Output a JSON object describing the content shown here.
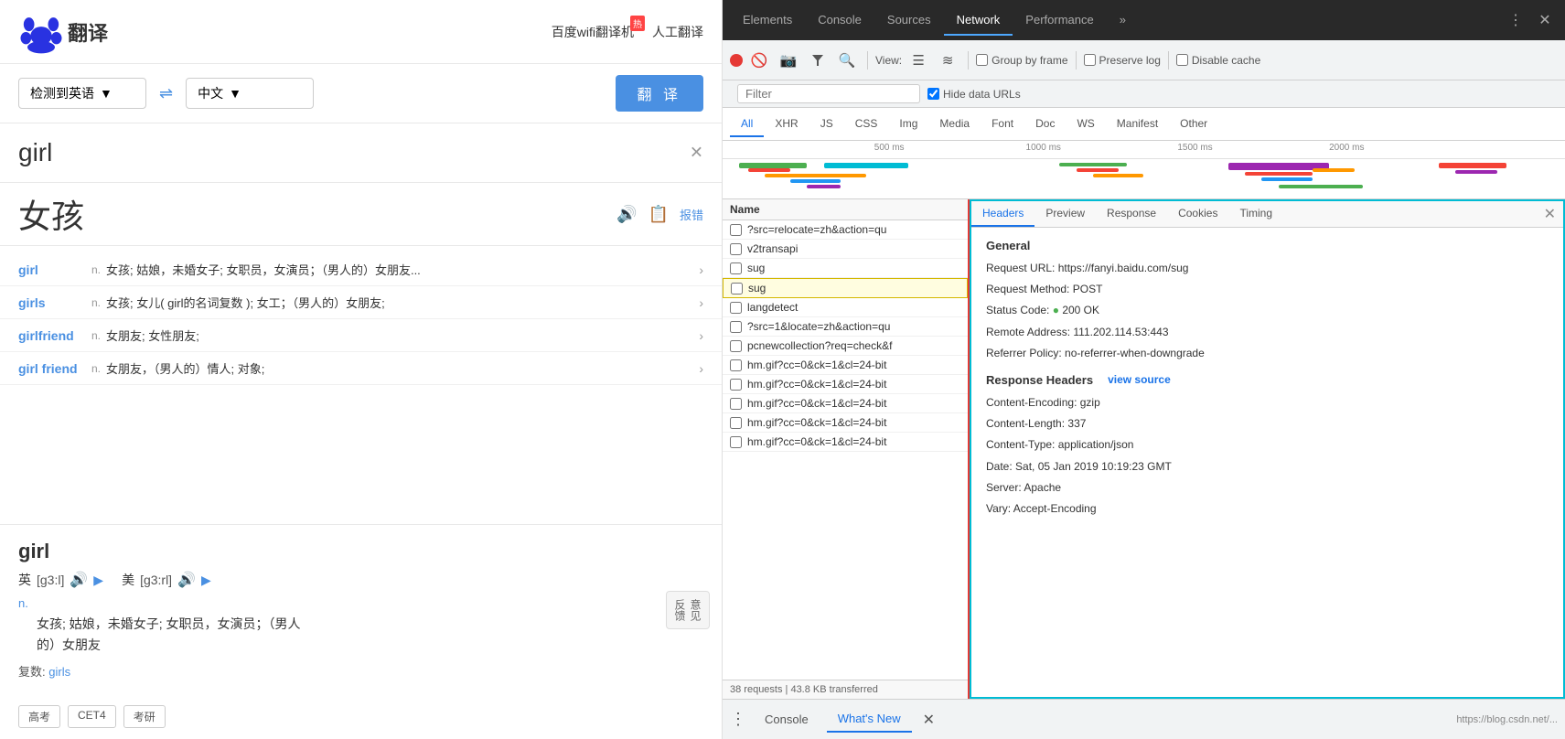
{
  "baidu": {
    "logo_text": "翻译",
    "header_links": [
      {
        "label": "百度wifi翻译机",
        "hot": true
      },
      {
        "label": "人工翻译",
        "hot": false
      }
    ],
    "source_lang": "检测到英语",
    "target_lang": "中文",
    "translate_btn": "翻 译",
    "search_word": "girl",
    "result_word": "女孩",
    "word_entries": [
      {
        "term": "girl",
        "pos": "n.",
        "def": "女孩; 姑娘，未婚女子; 女职员，女演员；（男人的）女朋友..."
      },
      {
        "term": "girls",
        "pos": "n.",
        "def": "女孩; 女儿( girl的名词复数 ); 女工；（男人的）女朋友;"
      },
      {
        "term": "girlfriend",
        "pos": "n.",
        "def": "女朋友; 女性朋友;"
      },
      {
        "term": "girl friend",
        "pos": "n.",
        "def": "女朋友，（男人的）情人; 对象;"
      }
    ],
    "detail_word": "girl",
    "phonetics": [
      {
        "label": "英",
        "text": "[g3:l]"
      },
      {
        "label": "美",
        "text": "[g3:rl]"
      }
    ],
    "def_pos": "n.",
    "def_text": "女孩; 姑娘，未婚女子; 女职员，女演员；（男人\n的）女朋友",
    "plural_label": "复数:",
    "plural_word": "girls",
    "tags": [
      "高考",
      "CET4",
      "考研"
    ],
    "action_report": "报错",
    "feedback_label": "意见\n反馈"
  },
  "devtools": {
    "top_tabs": [
      "Elements",
      "Console",
      "Sources",
      "Network",
      "Performance"
    ],
    "active_top_tab": "Network",
    "toolbar": {
      "filter_placeholder": "Filter",
      "hide_data_urls_label": "Hide data URLs",
      "view_label": "View:",
      "group_by_frame_label": "Group by frame",
      "preserve_log_label": "Preserve log",
      "disable_cache_label": "Disable cache"
    },
    "filter_tabs": [
      "All",
      "XHR",
      "JS",
      "CSS",
      "Img",
      "Media",
      "Font",
      "Doc",
      "WS",
      "Manifest",
      "Other"
    ],
    "active_filter_tab": "All",
    "timeline": {
      "markers": [
        "500 ms",
        "1000 ms",
        "1500 ms",
        "2000 ms"
      ]
    },
    "network_list": {
      "header": "Name",
      "rows": [
        {
          "name": "?src=relocate=zh&action=qu",
          "selected": false,
          "truncated": true
        },
        {
          "name": "v2transapi",
          "selected": false
        },
        {
          "name": "sug",
          "selected": false
        },
        {
          "name": "sug",
          "selected": true,
          "highlighted": true
        },
        {
          "name": "langdetect",
          "selected": false
        },
        {
          "name": "?src=1&locate=zh&action=qu",
          "selected": false,
          "truncated": true
        },
        {
          "name": "pcnewcollection?req=check&f",
          "selected": false,
          "truncated": true
        },
        {
          "name": "hm.gif?cc=0&ck=1&cl=24-bit",
          "selected": false,
          "truncated": true
        },
        {
          "name": "hm.gif?cc=0&ck=1&cl=24-bit",
          "selected": false,
          "truncated": true
        },
        {
          "name": "hm.gif?cc=0&ck=1&cl=24-bit",
          "selected": false,
          "truncated": true
        },
        {
          "name": "hm.gif?cc=0&ck=1&cl=24-bit",
          "selected": false,
          "truncated": true
        },
        {
          "name": "hm.gif?cc=0&ck=1&cl=24-bit",
          "selected": false,
          "truncated": true
        }
      ],
      "status": "38 requests | 43.8 KB transferred"
    },
    "headers_panel": {
      "tabs": [
        "Headers",
        "Preview",
        "Response",
        "Cookies",
        "Timing"
      ],
      "active_tab": "Headers",
      "general": {
        "title": "General",
        "request_url_label": "Request URL:",
        "request_url_value": "https://fanyi.baidu.com/sug",
        "request_method_label": "Request Method:",
        "request_method_value": "POST",
        "status_code_label": "Status Code:",
        "status_code_value": "200 OK",
        "remote_address_label": "Remote Address:",
        "remote_address_value": "111.202.114.53:443",
        "referrer_policy_label": "Referrer Policy:",
        "referrer_policy_value": "no-referrer-when-downgrade"
      },
      "response_headers": {
        "title": "Response Headers",
        "view_source": "view source",
        "items": [
          {
            "key": "Content-Encoding:",
            "value": "gzip"
          },
          {
            "key": "Content-Length:",
            "value": "337"
          },
          {
            "key": "Content-Type:",
            "value": "application/json"
          },
          {
            "key": "Date:",
            "value": "Sat, 05 Jan 2019 10:19:23 GMT"
          },
          {
            "key": "Server:",
            "value": "Apache"
          },
          {
            "key": "Vary:",
            "value": "Accept-Encoding"
          }
        ]
      }
    },
    "bottom_bar": {
      "console_label": "Console",
      "whats_new_label": "What's New",
      "bottom_url": "https://blog.csdn.net/..."
    }
  }
}
